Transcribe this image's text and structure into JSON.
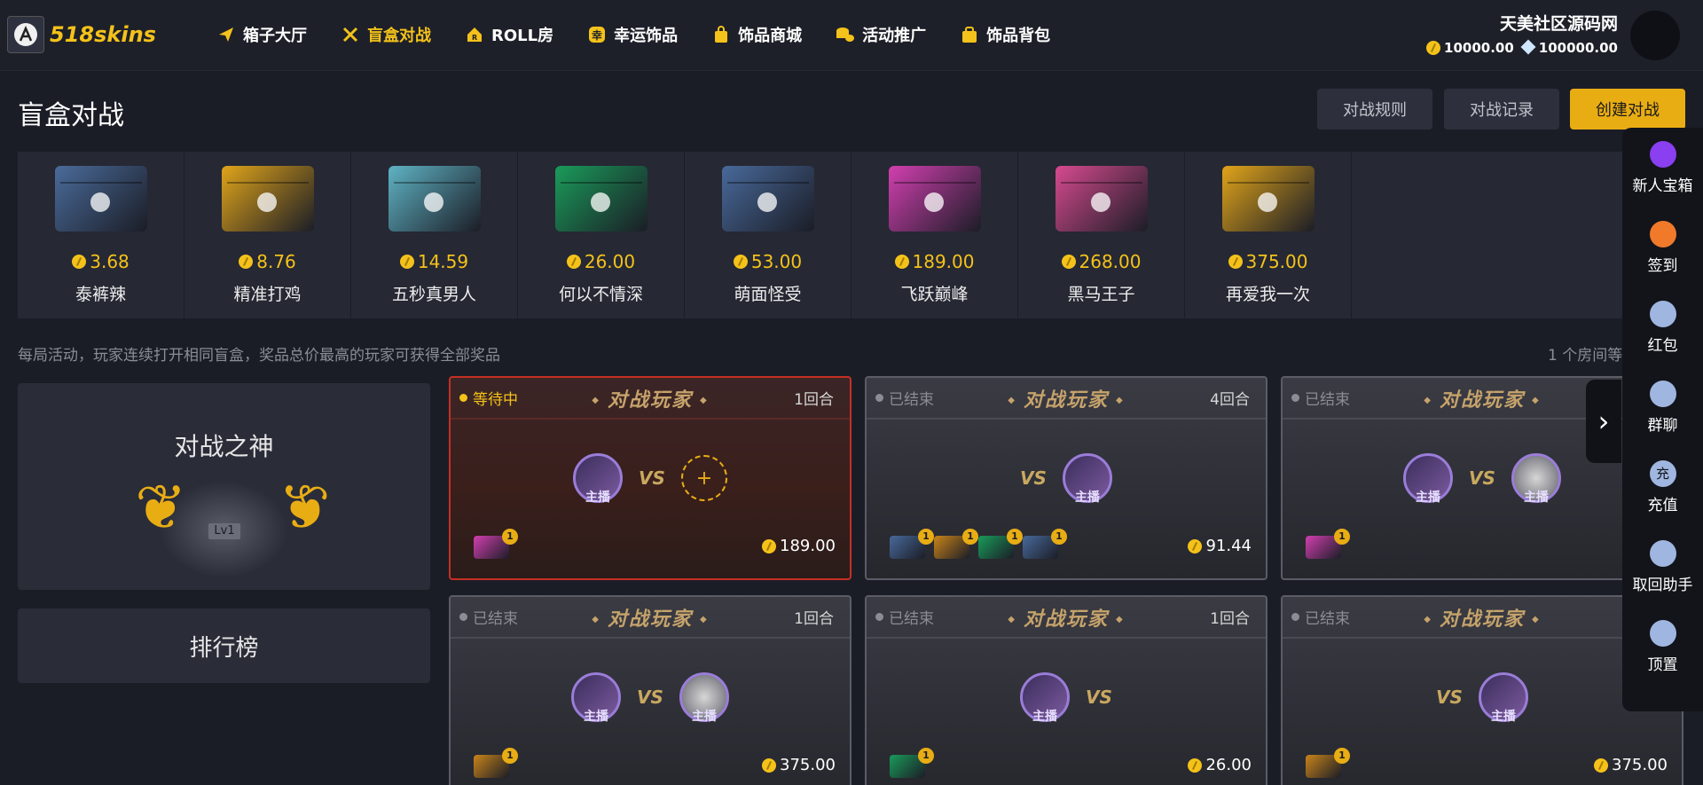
{
  "header": {
    "logo_text": "518skins",
    "nav": [
      {
        "label": "箱子大厅",
        "icon": "paper-plane-icon",
        "active": false
      },
      {
        "label": "盲盒对战",
        "icon": "crossed-swords-icon",
        "active": true
      },
      {
        "label": "ROLL房",
        "icon": "house-r-icon",
        "active": false
      },
      {
        "label": "幸运饰品",
        "icon": "lucky-badge-icon",
        "active": false
      },
      {
        "label": "饰品商城",
        "icon": "shopping-bag-icon",
        "active": false
      },
      {
        "label": "活动推广",
        "icon": "coins-icon",
        "active": false
      },
      {
        "label": "饰品背包",
        "icon": "backpack-icon",
        "active": false
      }
    ],
    "user": {
      "name": "天美社区源码网",
      "coins": "10000.00",
      "diamonds": "100000.00"
    }
  },
  "page": {
    "title": "盲盒对战",
    "buttons": {
      "rules": "对战规则",
      "records": "对战记录",
      "create": "创建对战"
    },
    "notice": "每局活动，玩家连续打开相同盲盒，奖品总价最高的玩家可获得全部奖品",
    "room_count": "1 个房间等"
  },
  "cases": [
    {
      "price": "3.68",
      "name": "泰裤辣",
      "color": "#4a6b9a"
    },
    {
      "price": "8.76",
      "name": "精准打鸡",
      "color": "#e0a41a"
    },
    {
      "price": "14.59",
      "name": "五秒真男人",
      "color": "#5fb3c4"
    },
    {
      "price": "26.00",
      "name": "何以不情深",
      "color": "#1a9b5a"
    },
    {
      "price": "53.00",
      "name": "萌面怪受",
      "color": "#48699a"
    },
    {
      "price": "189.00",
      "name": "飞跃巅峰",
      "color": "#d23fb0"
    },
    {
      "price": "268.00",
      "name": "黑马王子",
      "color": "#d64a8f"
    },
    {
      "price": "375.00",
      "name": "再爱我一次",
      "color": "#e0a41a"
    }
  ],
  "god_panel": {
    "title": "对战之神",
    "level": "Lv1"
  },
  "rank_button": "排行榜",
  "battles": [
    {
      "status": "等待中",
      "title": "对战玩家",
      "rounds": "1回合",
      "price": "189.00",
      "tag": "主播",
      "boxes": [
        {
          "color": "#d23fb0",
          "count": "1"
        }
      ]
    },
    {
      "status": "已结束",
      "title": "对战玩家",
      "rounds": "4回合",
      "price": "91.44",
      "tag": "主播",
      "boxes": [
        {
          "color": "#48699a",
          "count": "1"
        },
        {
          "color": "#c9841a",
          "count": "1"
        },
        {
          "color": "#1a9b5a",
          "count": "1"
        },
        {
          "color": "#48699a",
          "count": "1"
        }
      ]
    },
    {
      "status": "已结束",
      "title": "对战玩家",
      "rounds": "",
      "price": "",
      "tag": "主播",
      "boxes": [
        {
          "color": "#d23fb0",
          "count": "1"
        }
      ]
    },
    {
      "status": "已结束",
      "title": "对战玩家",
      "rounds": "1回合",
      "price": "375.00",
      "tag": "主播",
      "boxes": [
        {
          "color": "#c9841a",
          "count": "1"
        }
      ]
    },
    {
      "status": "已结束",
      "title": "对战玩家",
      "rounds": "1回合",
      "price": "26.00",
      "tag": "主播",
      "boxes": [
        {
          "color": "#1a9b5a",
          "count": "1"
        }
      ]
    },
    {
      "status": "已结束",
      "title": "对战玩家",
      "rounds": "",
      "price": "375.00",
      "tag": "主播",
      "boxes": [
        {
          "color": "#c9841a",
          "count": "1"
        }
      ]
    }
  ],
  "vs_text": "VS",
  "float_bar": [
    {
      "label": "新人宝箱",
      "icon": "gift-box-icon",
      "color": "#8a3ff0"
    },
    {
      "label": "签到",
      "icon": "checkin-icon",
      "color": "#f07a2a"
    },
    {
      "label": "红包",
      "icon": "red-packet-icon",
      "color": "#9fb6e0"
    },
    {
      "label": "群聊",
      "icon": "qq-penguin-icon",
      "color": "#9fb6e0"
    },
    {
      "label": "充值",
      "icon": "recharge-icon",
      "color": "#9fb6e0",
      "glyph": "充"
    },
    {
      "label": "取回助手",
      "icon": "chat-bubble-icon",
      "color": "#9fb6e0"
    },
    {
      "label": "顶置",
      "icon": "rocket-icon",
      "color": "#9fb6e0"
    }
  ]
}
